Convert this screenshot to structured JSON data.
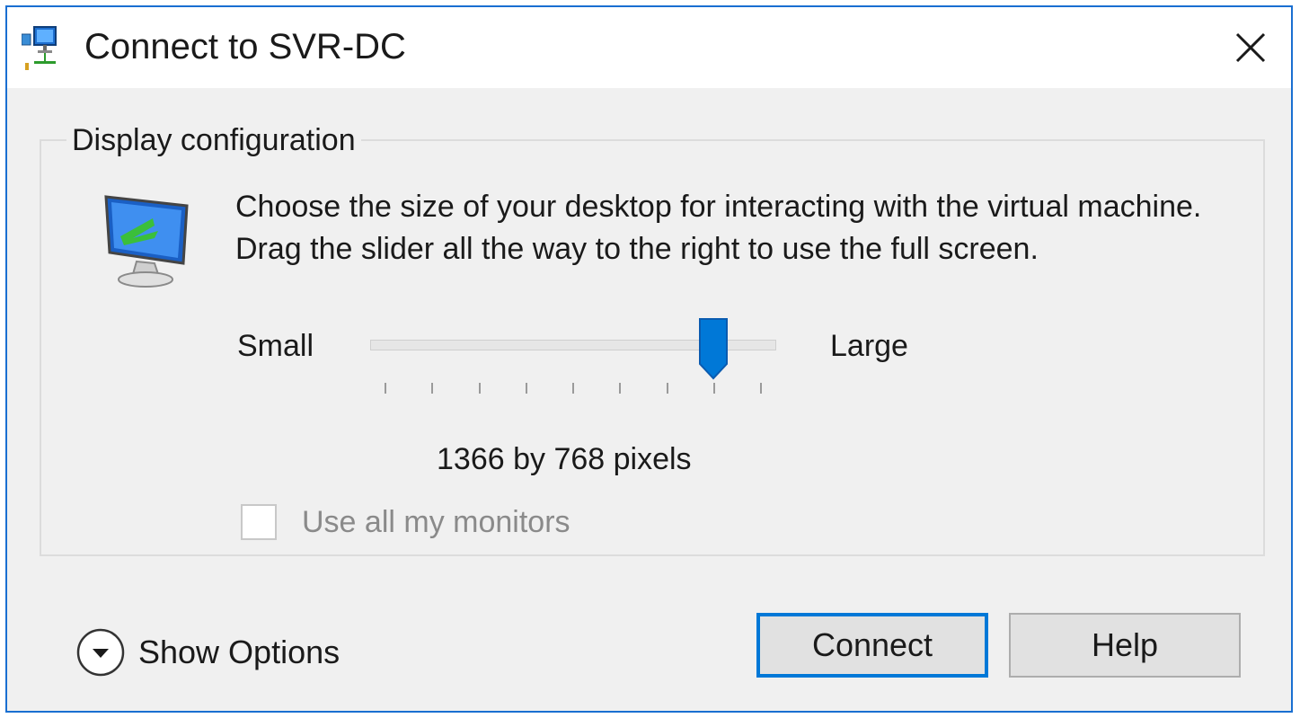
{
  "window": {
    "title": "Connect to SVR-DC",
    "accent_color": "#0078d7",
    "title_icon": "remote-desktop-connection-icon",
    "close_icon": "close-icon"
  },
  "display_config": {
    "group_label": "Display configuration",
    "icon": "monitor-resize-icon",
    "description": "Choose the size of your desktop for interacting with the virtual machine. Drag the slider all the way to the right to use the full screen.",
    "slider": {
      "min_label": "Small",
      "max_label": "Large",
      "tick_count": 9,
      "position_index": 7
    },
    "resolution_text": "1366 by 768 pixels",
    "use_all_monitors": {
      "label": "Use all my monitors",
      "checked": false,
      "enabled": false
    }
  },
  "footer": {
    "show_options_label": "Show Options",
    "show_options_icon": "chevron-down-circle-icon",
    "connect_label": "Connect",
    "help_label": "Help"
  }
}
